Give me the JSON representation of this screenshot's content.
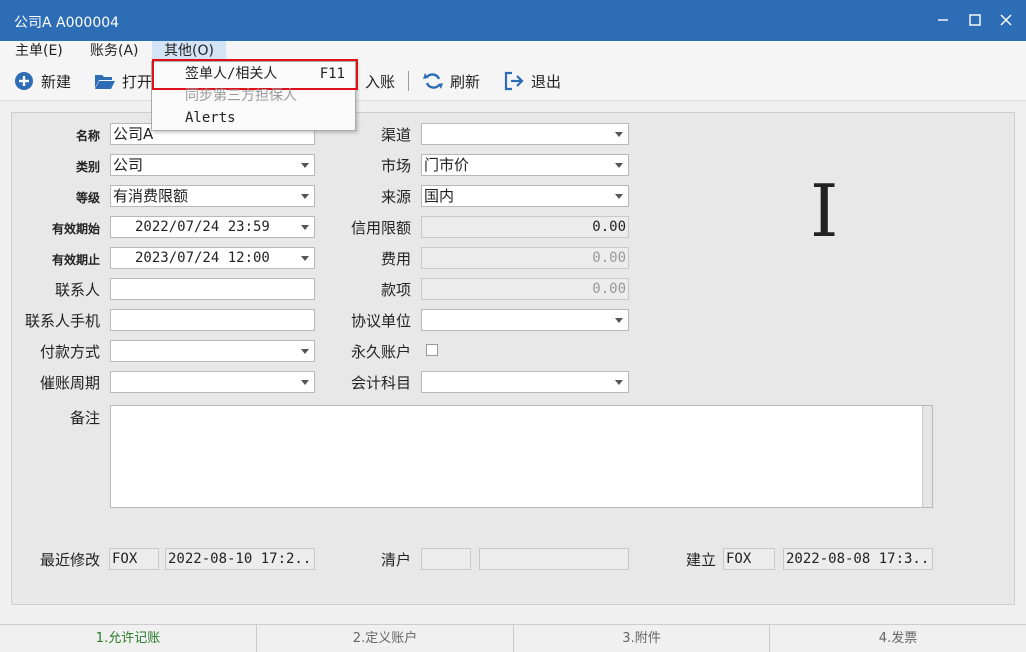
{
  "window": {
    "title": "公司A  A000004"
  },
  "menubar": [
    {
      "label": "主单(E)"
    },
    {
      "label": "账务(A)"
    },
    {
      "label": "其他(O)"
    }
  ],
  "toolbar": {
    "new": "新建",
    "open": "打开",
    "post": "入账",
    "refresh": "刷新",
    "exit": "退出"
  },
  "dropdown": {
    "items": [
      {
        "label": "签单人/相关人",
        "shortcut": "F11"
      },
      {
        "label": "同步第三方担保人",
        "shortcut": ""
      },
      {
        "label": "Alerts",
        "shortcut": ""
      }
    ]
  },
  "form": {
    "name": {
      "label": "名称",
      "value": "公司A"
    },
    "category": {
      "label": "类别",
      "value": "公司"
    },
    "level": {
      "label": "等级",
      "value": "有消费限额"
    },
    "valid_from": {
      "label": "有效期始",
      "value": "2022/07/24 23:59"
    },
    "valid_to": {
      "label": "有效期止",
      "value": "2023/07/24 12:00"
    },
    "contact": {
      "label": "联系人",
      "value": ""
    },
    "contact_phone": {
      "label": "联系人手机",
      "value": ""
    },
    "payment": {
      "label": "付款方式",
      "value": ""
    },
    "dunning": {
      "label": "催账周期",
      "value": ""
    },
    "channel": {
      "label": "渠道",
      "value": ""
    },
    "market": {
      "label": "市场",
      "value": "门市价"
    },
    "source": {
      "label": "来源",
      "value": "国内"
    },
    "credit": {
      "label": "信用限额",
      "value": "0.00"
    },
    "fee": {
      "label": "费用",
      "value": "0.00"
    },
    "payment_item": {
      "label": "款项",
      "value": "0.00"
    },
    "agreement": {
      "label": "协议单位",
      "value": ""
    },
    "permanent": {
      "label": "永久账户",
      "checked": false
    },
    "account_subject": {
      "label": "会计科目",
      "value": ""
    },
    "memo": {
      "label": "备注",
      "value": ""
    },
    "cursor_glyph": "I",
    "last_modified": {
      "label": "最近修改",
      "user": "FOX",
      "time": "2022-08-10 17:2..."
    },
    "clear": {
      "label": "清户",
      "user": "",
      "time": ""
    },
    "created": {
      "label": "建立",
      "user": "FOX",
      "time": "2022-08-08 17:3..."
    }
  },
  "tabs": [
    {
      "label": "1.允许记账",
      "active": true
    },
    {
      "label": "2.定义账户",
      "active": false
    },
    {
      "label": "3.附件",
      "active": false
    },
    {
      "label": "4.发票",
      "active": false
    }
  ],
  "colors": {
    "titlebar": "#2d6db5",
    "highlight": "#e0101a",
    "active_tab": "#2a7a2a"
  }
}
